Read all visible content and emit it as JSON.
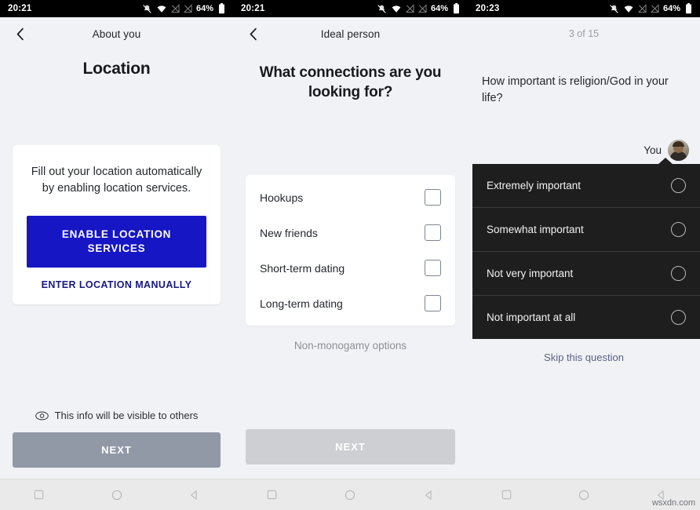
{
  "watermark": "wsxdn.com",
  "screens": [
    {
      "status": {
        "time": "20:21",
        "battery": "64%",
        "icons": [
          "bell-muted-icon",
          "wifi-icon",
          "signal-off-icon",
          "signal-off-icon",
          "battery-icon"
        ]
      },
      "nav": {
        "back": "back-arrow",
        "title": "About you"
      },
      "heading": "Location",
      "card": {
        "text": "Fill out your location automatically by enabling location services.",
        "primary_button": "ENABLE LOCATION SERVICES",
        "link_button": "ENTER LOCATION MANUALLY"
      },
      "footer": {
        "note": "This info will be visible to others",
        "note_icon": "eye-icon",
        "next_label": "NEXT"
      }
    },
    {
      "status": {
        "time": "20:21",
        "battery": "64%"
      },
      "nav": {
        "back": "back-arrow",
        "title": "Ideal person"
      },
      "heading": "What connections are you looking for?",
      "options": [
        {
          "label": "Hookups",
          "checked": false
        },
        {
          "label": "New friends",
          "checked": false
        },
        {
          "label": "Short-term dating",
          "checked": false
        },
        {
          "label": "Long-term dating",
          "checked": false
        }
      ],
      "sub_link": "Non-monogamy options",
      "footer": {
        "next_label": "NEXT"
      }
    },
    {
      "status": {
        "time": "20:23",
        "battery": "64%"
      },
      "step_counter": "3 of 15",
      "question": "How important is religion/God in your life?",
      "you_label": "You",
      "avatar": "user-avatar",
      "answers": [
        {
          "label": "Extremely important",
          "selected": false
        },
        {
          "label": "Somewhat important",
          "selected": false
        },
        {
          "label": "Not very important",
          "selected": false
        },
        {
          "label": "Not important at all",
          "selected": false
        }
      ],
      "skip_label": "Skip this question"
    }
  ],
  "navbar": {
    "recents": "square-icon",
    "home": "circle-icon",
    "back": "triangle-back-icon"
  },
  "colors": {
    "primary_blue": "#1616c4",
    "link_navy": "#181880",
    "dark_panel": "#1e1e1e",
    "page_bg": "#f1f2f5"
  }
}
